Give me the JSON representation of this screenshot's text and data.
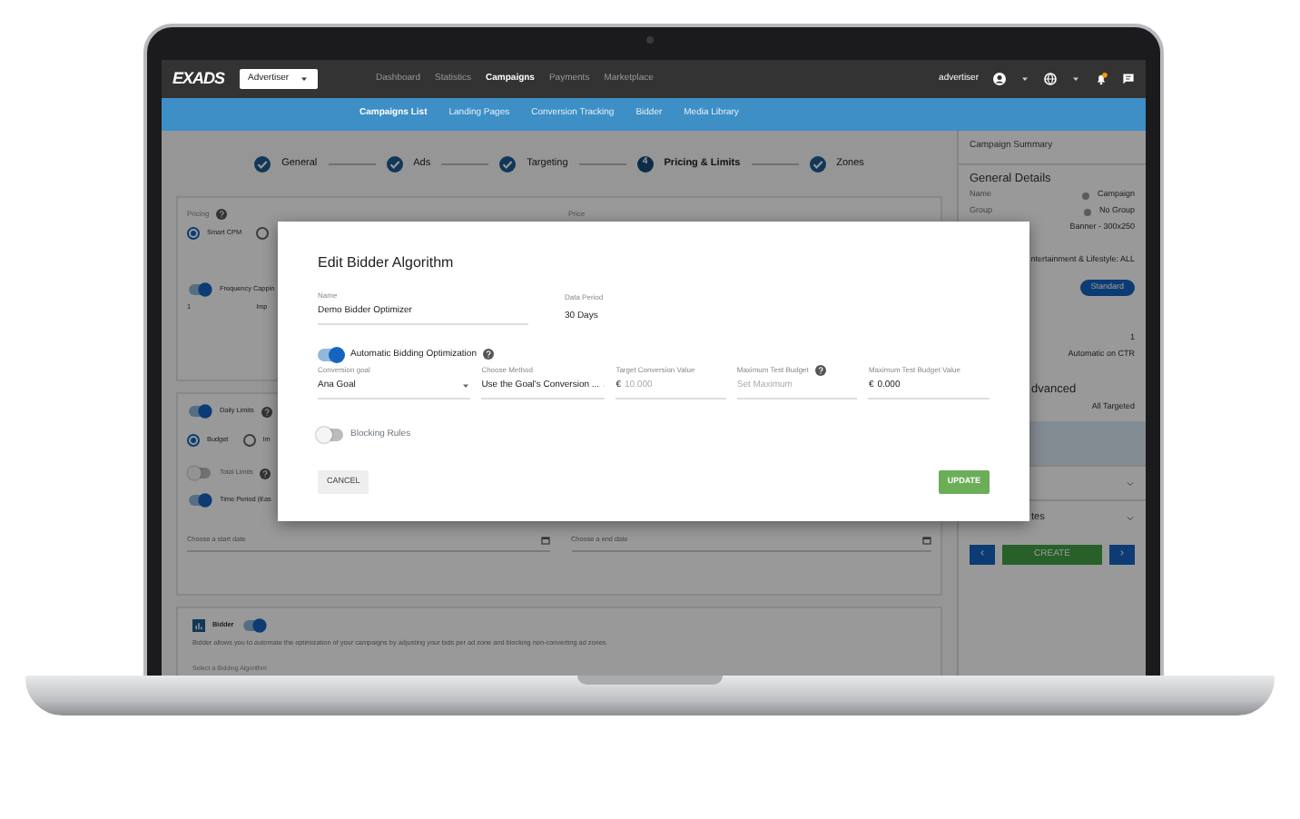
{
  "nav": {
    "logo": "EXADS",
    "account": "Advertiser",
    "user": "advertiser",
    "links": [
      {
        "label": "Dashboard",
        "selected": false
      },
      {
        "label": "Statistics",
        "selected": false
      },
      {
        "label": "Campaigns",
        "selected": true
      },
      {
        "label": "Payments",
        "selected": false
      },
      {
        "label": "Marketplace",
        "selected": false
      }
    ]
  },
  "subnav": [
    {
      "label": "Campaigns List",
      "selected": true
    },
    {
      "label": "Landing Pages",
      "selected": false
    },
    {
      "label": "Conversion Tracking",
      "selected": false
    },
    {
      "label": "Bidder",
      "selected": false
    },
    {
      "label": "Media Library",
      "selected": false
    }
  ],
  "steps": [
    {
      "label": "General",
      "kind": "done"
    },
    {
      "label": "Ads",
      "kind": "done"
    },
    {
      "label": "Targeting",
      "kind": "done"
    },
    {
      "label": "Pricing & Limits",
      "kind": "current",
      "number": "4"
    },
    {
      "label": "Zones",
      "kind": "done"
    }
  ],
  "pricing": {
    "label": "Pricing",
    "price_label": "Price",
    "options": [
      {
        "label": "Smart CPM",
        "selected": true
      },
      {
        "selected": false
      }
    ],
    "frequency": {
      "label": "Frequency Cappin",
      "on": true,
      "value": "1",
      "unit": "Imp"
    }
  },
  "limits": {
    "daily": {
      "label": "Daily Limits",
      "on": true
    },
    "options": [
      {
        "label": "Budget",
        "selected": true
      },
      {
        "label": "Im",
        "selected": false
      }
    ],
    "total": {
      "label": "Total Limits",
      "on": false
    },
    "period": {
      "label": "Time Period (Eas",
      "on": true
    },
    "start_placeholder": "Choose a start date",
    "end_placeholder": "Choose a end date"
  },
  "bidder": {
    "title": "Bidder",
    "on": true,
    "description": "Bidder allows you to automate the optimization of your campaigns by adjusting your bids per ad zone and blocking non-converting ad zones.",
    "select_label": "Select a Bidding Algorithm"
  },
  "summary": {
    "title": "Campaign Summary",
    "items": [
      {
        "kind": "heading",
        "text": "General Details"
      },
      {
        "kind": "row",
        "label": "Name",
        "value": "Campaign"
      },
      {
        "kind": "row",
        "label": "Group",
        "value": "No Group"
      },
      {
        "kind": "value",
        "value": "Banner - 300x250"
      },
      {
        "kind": "value",
        "value": "ntertainment & Lifestyle: ALL"
      },
      {
        "kind": "pill",
        "value": "Standard"
      },
      {
        "kind": "value",
        "value": "1"
      },
      {
        "kind": "value",
        "value": "Automatic on CTR"
      },
      {
        "kind": "heading_tail",
        "text": "dvanced"
      },
      {
        "kind": "value",
        "value": "All Targeted"
      },
      {
        "kind": "band"
      },
      {
        "kind": "collapse"
      },
      {
        "kind": "collapse",
        "text": "tes"
      }
    ],
    "create": "CREATE",
    "prev": "‹",
    "next": "›"
  },
  "modal": {
    "title": "Edit Bidder Algorithm",
    "name_label": "Name",
    "name_value": "Demo Bidder Optimizer",
    "period_label": "Data Period",
    "period_value": "30 Days",
    "auto": {
      "label": "Automatic Bidding Optimization",
      "on": true
    },
    "fields": [
      {
        "kind": "select",
        "label": "Conversion goal",
        "value": "Ana Goal"
      },
      {
        "kind": "select",
        "label": "Choose Method",
        "value": "Use the Goal's Conversion ..."
      },
      {
        "kind": "money",
        "label": "Target Conversion Value",
        "currency": "€",
        "placeholder": "10.000"
      },
      {
        "kind": "text",
        "label": "Maximum Test Budget",
        "help": true,
        "placeholder": "Set Maximum"
      },
      {
        "kind": "money",
        "label": "Maximum Test Budget Value",
        "currency": "€",
        "value": "0.000"
      }
    ],
    "blocking": {
      "label": "Blocking Rules",
      "on": false
    },
    "cancel": "CANCEL",
    "update": "UPDATE"
  }
}
